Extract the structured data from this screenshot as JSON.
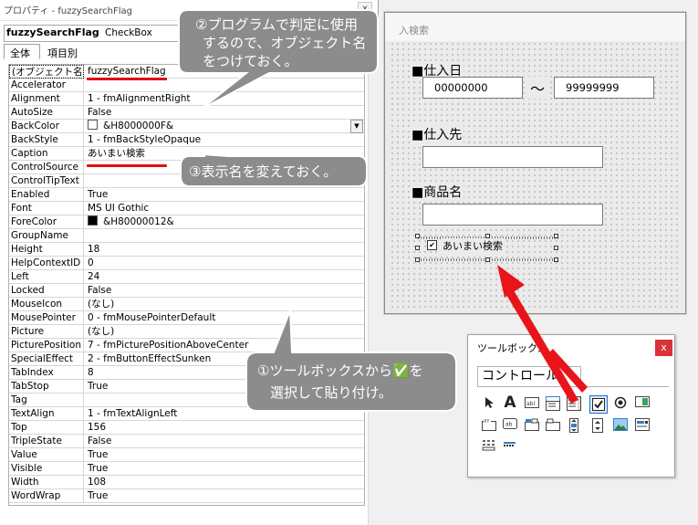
{
  "properties_window": {
    "title": "プロパティ - fuzzySearchFlag",
    "close_label": "x",
    "object_name": "fuzzySearchFlag",
    "object_type": "CheckBox",
    "tabs": [
      "全体",
      "項目別"
    ],
    "rows": [
      {
        "name": "(オブジェクト名)",
        "value": "fuzzySearchFlag"
      },
      {
        "name": "Accelerator",
        "value": ""
      },
      {
        "name": "Alignment",
        "value": "1 - fmAlignmentRight"
      },
      {
        "name": "AutoSize",
        "value": "False"
      },
      {
        "name": "BackColor",
        "value": "&H8000000F&"
      },
      {
        "name": "BackStyle",
        "value": "1 - fmBackStyleOpaque"
      },
      {
        "name": "Caption",
        "value": "あいまい検索"
      },
      {
        "name": "ControlSource",
        "value": ""
      },
      {
        "name": "ControlTipText",
        "value": ""
      },
      {
        "name": "Enabled",
        "value": "True"
      },
      {
        "name": "Font",
        "value": "MS UI Gothic"
      },
      {
        "name": "ForeColor",
        "value": "&H80000012&"
      },
      {
        "name": "GroupName",
        "value": ""
      },
      {
        "name": "Height",
        "value": "18"
      },
      {
        "name": "HelpContextID",
        "value": "0"
      },
      {
        "name": "Left",
        "value": "24"
      },
      {
        "name": "Locked",
        "value": "False"
      },
      {
        "name": "MouseIcon",
        "value": "(なし)"
      },
      {
        "name": "MousePointer",
        "value": "0 - fmMousePointerDefault"
      },
      {
        "name": "Picture",
        "value": "(なし)"
      },
      {
        "name": "PicturePosition",
        "value": "7 - fmPicturePositionAboveCenter"
      },
      {
        "name": "SpecialEffect",
        "value": "2 - fmButtonEffectSunken"
      },
      {
        "name": "TabIndex",
        "value": "8"
      },
      {
        "name": "TabStop",
        "value": "True"
      },
      {
        "name": "Tag",
        "value": ""
      },
      {
        "name": "TextAlign",
        "value": "1 - fmTextAlignLeft"
      },
      {
        "name": "Top",
        "value": "156"
      },
      {
        "name": "TripleState",
        "value": "False"
      },
      {
        "name": "Value",
        "value": "True"
      },
      {
        "name": "Visible",
        "value": "True"
      },
      {
        "name": "Width",
        "value": "108"
      },
      {
        "name": "WordWrap",
        "value": "True"
      }
    ],
    "backcolor_swatch": "#ffffff",
    "forecolor_swatch": "#000000"
  },
  "form": {
    "title": "入検索",
    "label_date": "■仕入日",
    "date_from": "00000000",
    "tilde": "～",
    "date_to": "99999999",
    "label_supplier": "■仕入先",
    "label_product": "■商品名",
    "checkbox_caption": "あいまい検索",
    "checkbox_mark": "✔"
  },
  "toolbox": {
    "title": "ツールボックス",
    "close_label": "x",
    "tab_label": "コントロール"
  },
  "callouts": {
    "c2_line1": "②プログラムで判定に使用",
    "c2_line2": "するので、オブジェクト名",
    "c2_line3": "をつけておく。",
    "c3": "③表示名を変えておく。",
    "c1_line1": "①ツールボックスから✅を",
    "c1_line2": "選択して貼り付け。"
  },
  "colors": {
    "callout_fill": "#8c8c8c",
    "arrow_red": "#e8141a",
    "underline_red": "#e01010"
  }
}
